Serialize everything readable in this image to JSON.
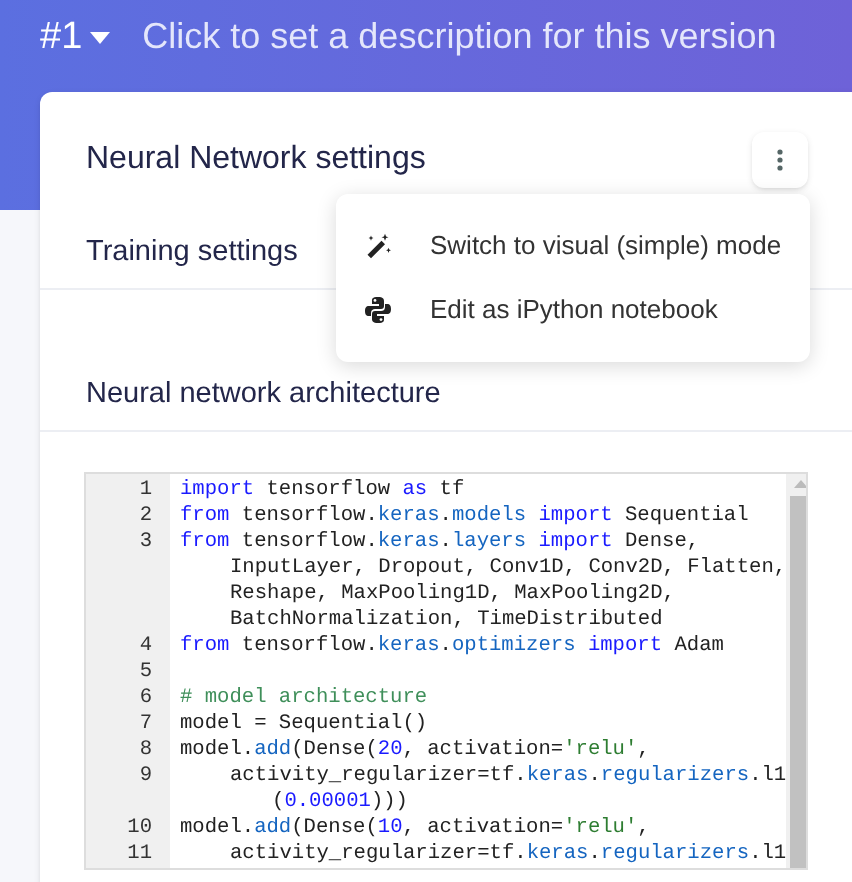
{
  "header": {
    "version": "#1",
    "description": "Click to set a description for this version"
  },
  "card": {
    "title": "Neural Network settings",
    "sections": [
      "Training settings",
      "Neural network architecture"
    ]
  },
  "menu": {
    "items": [
      {
        "label": "Switch to visual (simple) mode"
      },
      {
        "label": "Edit as iPython notebook"
      }
    ]
  },
  "code": [
    {
      "number": "1",
      "kind": "line",
      "tokens": [
        {
          "text": "import",
          "kind": "keyword"
        },
        {
          "text": " tensorflow ",
          "kind": "plain"
        },
        {
          "text": "as",
          "kind": "keyword"
        },
        {
          "text": " tf",
          "kind": "plain"
        }
      ]
    },
    {
      "number": "2",
      "kind": "line",
      "tokens": [
        {
          "text": "from",
          "kind": "keyword"
        },
        {
          "text": " tensorflow.",
          "kind": "plain"
        },
        {
          "text": "keras",
          "kind": "module"
        },
        {
          "text": ".",
          "kind": "plain"
        },
        {
          "text": "models",
          "kind": "module"
        },
        {
          "text": " import",
          "kind": "keyword"
        },
        {
          "text": " Sequential",
          "kind": "plain"
        }
      ]
    },
    {
      "number": "3",
      "kind": "line",
      "tokens": [
        {
          "text": "from",
          "kind": "keyword"
        },
        {
          "text": " tensorflow.",
          "kind": "plain"
        },
        {
          "text": "keras",
          "kind": "module"
        },
        {
          "text": ".",
          "kind": "plain"
        },
        {
          "text": "layers",
          "kind": "module"
        },
        {
          "text": " import",
          "kind": "keyword"
        },
        {
          "text": " Dense,",
          "kind": "plain"
        }
      ]
    },
    {
      "kind": "wrap",
      "tokens": [
        {
          "text": "InputLayer, Dropout, Conv1D, Conv2D, Flatten,",
          "kind": "plain"
        }
      ]
    },
    {
      "kind": "wrap",
      "tokens": [
        {
          "text": "Reshape, MaxPooling1D, MaxPooling2D,",
          "kind": "plain"
        }
      ]
    },
    {
      "kind": "wrap",
      "tokens": [
        {
          "text": "BatchNormalization, TimeDistributed",
          "kind": "plain"
        }
      ]
    },
    {
      "number": "4",
      "kind": "line",
      "tokens": [
        {
          "text": "from",
          "kind": "keyword"
        },
        {
          "text": " tensorflow.",
          "kind": "plain"
        },
        {
          "text": "keras",
          "kind": "module"
        },
        {
          "text": ".",
          "kind": "plain"
        },
        {
          "text": "optimizers",
          "kind": "module"
        },
        {
          "text": " import",
          "kind": "keyword"
        },
        {
          "text": " Adam",
          "kind": "plain"
        }
      ]
    },
    {
      "number": "5",
      "kind": "line"
    },
    {
      "number": "6",
      "kind": "line",
      "tokens": [
        {
          "text": "# model architecture",
          "kind": "comment"
        }
      ]
    },
    {
      "number": "7",
      "kind": "line",
      "tokens": [
        {
          "text": "model = Sequential()",
          "kind": "plain"
        }
      ]
    },
    {
      "number": "8",
      "kind": "line",
      "tokens": [
        {
          "text": "model.",
          "kind": "plain"
        },
        {
          "text": "add",
          "kind": "module"
        },
        {
          "text": "(Dense(",
          "kind": "plain"
        },
        {
          "text": "20",
          "kind": "number"
        },
        {
          "text": ", activation=",
          "kind": "plain"
        },
        {
          "text": "'relu'",
          "kind": "string"
        },
        {
          "text": ",",
          "kind": "plain"
        }
      ]
    },
    {
      "number": "9",
      "kind": "indented",
      "tokens": [
        {
          "text": "activity_regularizer=tf.",
          "kind": "plain"
        },
        {
          "text": "keras",
          "kind": "module"
        },
        {
          "text": ".",
          "kind": "plain"
        },
        {
          "text": "regularizers",
          "kind": "module"
        },
        {
          "text": ".l1",
          "kind": "plain"
        }
      ]
    },
    {
      "kind": "deep-wrap",
      "tokens": [
        {
          "text": "(",
          "kind": "plain"
        },
        {
          "text": "0.00001",
          "kind": "number"
        },
        {
          "text": ")))",
          "kind": "plain"
        }
      ]
    },
    {
      "number": "10",
      "kind": "line",
      "tokens": [
        {
          "text": "model.",
          "kind": "plain"
        },
        {
          "text": "add",
          "kind": "module"
        },
        {
          "text": "(Dense(",
          "kind": "plain"
        },
        {
          "text": "10",
          "kind": "number"
        },
        {
          "text": ", activation=",
          "kind": "plain"
        },
        {
          "text": "'relu'",
          "kind": "string"
        },
        {
          "text": ",",
          "kind": "plain"
        }
      ]
    },
    {
      "number": "11",
      "kind": "indented",
      "tokens": [
        {
          "text": "activity_regularizer=tf.",
          "kind": "plain"
        },
        {
          "text": "keras",
          "kind": "module"
        },
        {
          "text": ".",
          "kind": "plain"
        },
        {
          "text": "regularizers",
          "kind": "module"
        },
        {
          "text": ".l1",
          "kind": "plain"
        }
      ]
    }
  ]
}
